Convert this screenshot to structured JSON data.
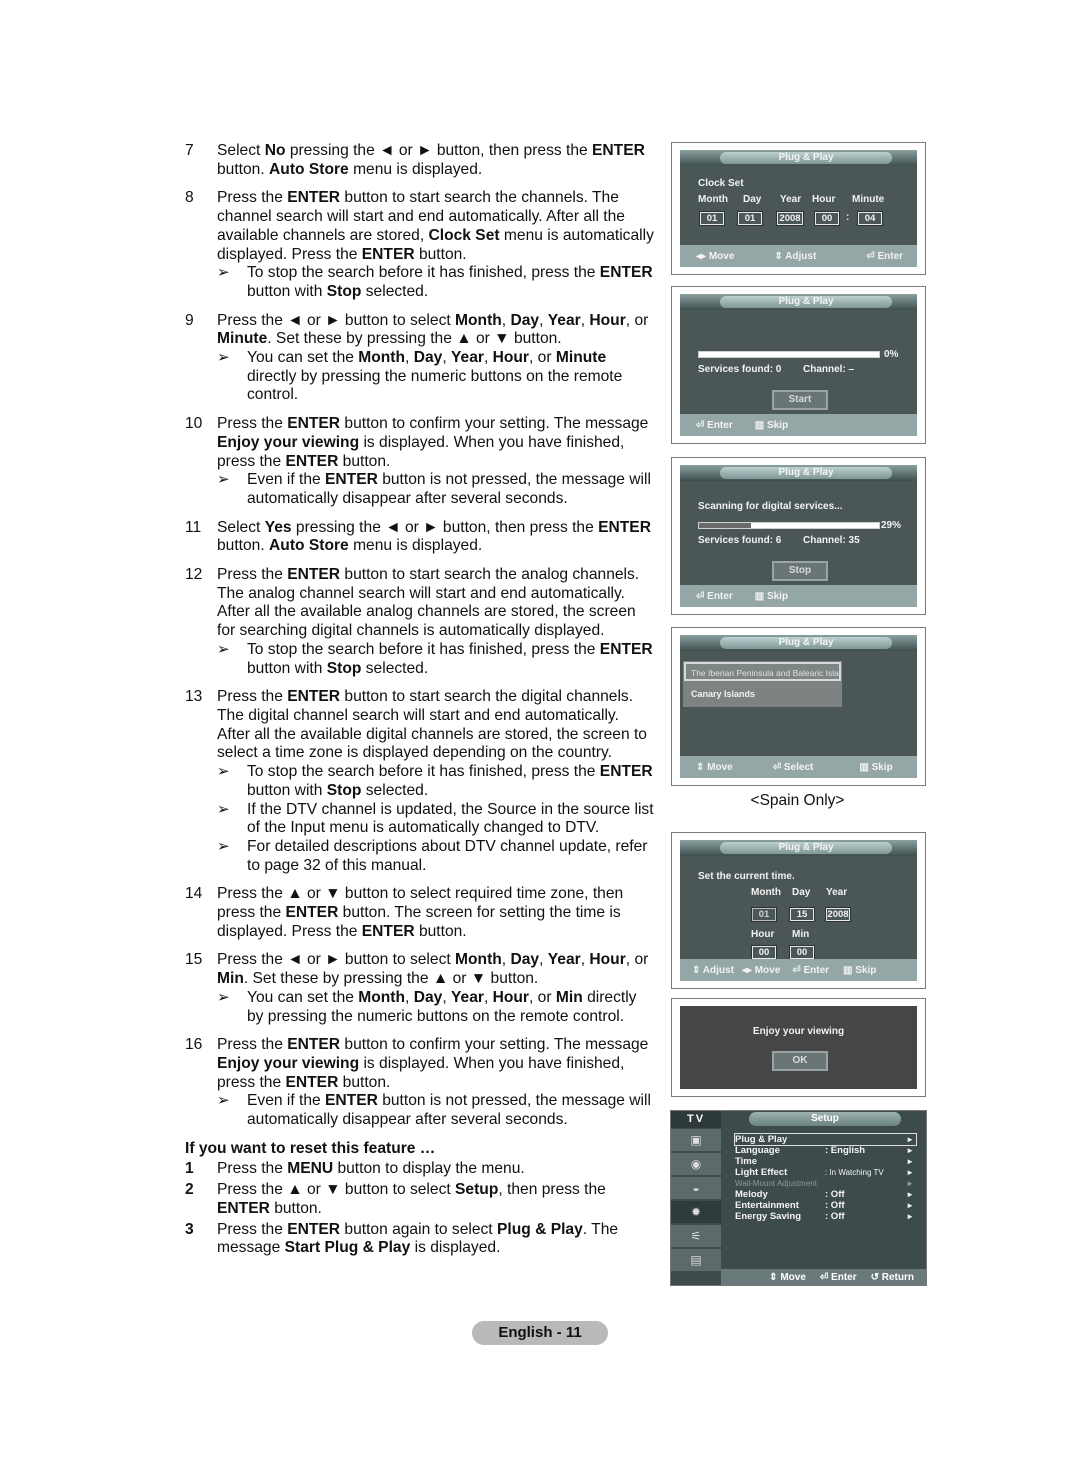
{
  "steps": [
    {
      "num": "7",
      "html": [
        [
          "t",
          "Select "
        ],
        [
          "b",
          "No"
        ],
        [
          "t",
          " pressing the ◄ or ► button, then press the "
        ],
        [
          "b",
          "ENTER"
        ],
        [
          "t",
          " button. "
        ],
        [
          "b",
          "Auto Store"
        ],
        [
          "t",
          " menu is displayed."
        ]
      ],
      "notes": []
    },
    {
      "num": "8",
      "html": [
        [
          "t",
          "Press the "
        ],
        [
          "b",
          "ENTER"
        ],
        [
          "t",
          " button to start search the channels. The channel search will start and end automatically. After all the available channels are stored, "
        ],
        [
          "b",
          "Clock Set"
        ],
        [
          "t",
          " menu is automatically displayed. Press the "
        ],
        [
          "b",
          "ENTER"
        ],
        [
          "t",
          " button."
        ]
      ],
      "notes": [
        [
          [
            "t",
            "To stop the search before it has finished, press the "
          ],
          [
            "b",
            "ENTER"
          ],
          [
            "t",
            " button with "
          ],
          [
            "b",
            "Stop"
          ],
          [
            "t",
            " selected."
          ]
        ]
      ]
    },
    {
      "num": "9",
      "html": [
        [
          "t",
          "Press the ◄ or ► button to select "
        ],
        [
          "b",
          "Month"
        ],
        [
          "t",
          ", "
        ],
        [
          "b",
          "Day"
        ],
        [
          "t",
          ", "
        ],
        [
          "b",
          "Year"
        ],
        [
          "t",
          ", "
        ],
        [
          "b",
          "Hour"
        ],
        [
          "t",
          ", or "
        ],
        [
          "b",
          "Minute"
        ],
        [
          "t",
          ". Set these by pressing the ▲ or ▼ button."
        ]
      ],
      "notes": [
        [
          [
            "t",
            "You can set the "
          ],
          [
            "b",
            "Month"
          ],
          [
            "t",
            ", "
          ],
          [
            "b",
            "Day"
          ],
          [
            "t",
            ", "
          ],
          [
            "b",
            "Year"
          ],
          [
            "t",
            ", "
          ],
          [
            "b",
            "Hour"
          ],
          [
            "t",
            ", or "
          ],
          [
            "b",
            "Minute"
          ],
          [
            "t",
            " directly by pressing the numeric buttons on the remote control."
          ]
        ]
      ]
    },
    {
      "num": "10",
      "html": [
        [
          "t",
          "Press the "
        ],
        [
          "b",
          "ENTER"
        ],
        [
          "t",
          " button to confirm your setting. The message "
        ],
        [
          "b",
          "Enjoy your viewing"
        ],
        [
          "t",
          " is displayed. When you have finished, press the "
        ],
        [
          "b",
          "ENTER"
        ],
        [
          "t",
          " button."
        ]
      ],
      "notes": [
        [
          [
            "t",
            "Even if the "
          ],
          [
            "b",
            "ENTER"
          ],
          [
            "t",
            " button is not pressed, the message will automatically disappear after several seconds."
          ]
        ]
      ]
    },
    {
      "num": "11",
      "html": [
        [
          "t",
          "Select "
        ],
        [
          "b",
          "Yes"
        ],
        [
          "t",
          " pressing the ◄ or ► button, then press the "
        ],
        [
          "b",
          "ENTER"
        ],
        [
          "t",
          " button. "
        ],
        [
          "b",
          "Auto Store"
        ],
        [
          "t",
          " menu is displayed."
        ]
      ],
      "notes": []
    },
    {
      "num": "12",
      "html": [
        [
          "t",
          "Press the "
        ],
        [
          "b",
          "ENTER"
        ],
        [
          "t",
          " button to start search the analog channels. The analog channel search will start and end automatically. After all the available analog channels are stored, the screen for searching digital channels is automatically displayed."
        ]
      ],
      "notes": [
        [
          [
            "t",
            "To stop the search before it has finished, press the "
          ],
          [
            "b",
            "ENTER"
          ],
          [
            "t",
            " button with "
          ],
          [
            "b",
            "Stop"
          ],
          [
            "t",
            " selected."
          ]
        ]
      ]
    },
    {
      "num": "13",
      "html": [
        [
          "t",
          "Press the "
        ],
        [
          "b",
          "ENTER"
        ],
        [
          "t",
          " button to start search the digital channels. The digital channel search will start and end automatically. After all the available digital channels are stored, the screen to select a time zone is displayed depending on the country."
        ]
      ],
      "notes": [
        [
          [
            "t",
            "To stop the search before it has finished, press the "
          ],
          [
            "b",
            "ENTER"
          ],
          [
            "t",
            " button with "
          ],
          [
            "b",
            "Stop"
          ],
          [
            "t",
            " selected."
          ]
        ],
        [
          [
            "t",
            "If the DTV channel is updated, the Source in the source list of the Input menu is automatically changed to DTV."
          ]
        ],
        [
          [
            "t",
            "For detailed descriptions about DTV channel update, refer to page 32 of this manual."
          ]
        ]
      ]
    },
    {
      "num": "14",
      "html": [
        [
          "t",
          "Press the ▲ or ▼ button to select required time zone, then press the "
        ],
        [
          "b",
          "ENTER"
        ],
        [
          "t",
          " button. The screen for setting the time is displayed. Press the "
        ],
        [
          "b",
          "ENTER"
        ],
        [
          "t",
          " button."
        ]
      ],
      "notes": []
    },
    {
      "num": "15",
      "html": [
        [
          "t",
          "Press the ◄ or ► button to select "
        ],
        [
          "b",
          "Month"
        ],
        [
          "t",
          ", "
        ],
        [
          "b",
          "Day"
        ],
        [
          "t",
          ", "
        ],
        [
          "b",
          "Year"
        ],
        [
          "t",
          ", "
        ],
        [
          "b",
          "Hour"
        ],
        [
          "t",
          ", or "
        ],
        [
          "b",
          "Min"
        ],
        [
          "t",
          ". Set these by pressing the ▲ or ▼ button."
        ]
      ],
      "notes": [
        [
          [
            "t",
            "You can set the "
          ],
          [
            "b",
            "Month"
          ],
          [
            "t",
            ", "
          ],
          [
            "b",
            "Day"
          ],
          [
            "t",
            ", "
          ],
          [
            "b",
            "Year"
          ],
          [
            "t",
            ", "
          ],
          [
            "b",
            "Hour"
          ],
          [
            "t",
            ", or "
          ],
          [
            "b",
            "Min"
          ],
          [
            "t",
            " directly by pressing the numeric buttons on the remote control."
          ]
        ]
      ]
    },
    {
      "num": "16",
      "html": [
        [
          "t",
          "Press the "
        ],
        [
          "b",
          "ENTER"
        ],
        [
          "t",
          " button to confirm your setting. The message "
        ],
        [
          "b",
          "Enjoy your viewing"
        ],
        [
          "t",
          " is displayed. When you have finished, press the "
        ],
        [
          "b",
          "ENTER"
        ],
        [
          "t",
          " button."
        ]
      ],
      "notes": [
        [
          [
            "t",
            "Even if the "
          ],
          [
            "b",
            "ENTER"
          ],
          [
            "t",
            " button is not pressed, the message will automatically disappear after several seconds."
          ]
        ]
      ]
    }
  ],
  "note_arrow": "➢",
  "reset": {
    "title": "If you want to reset this feature …",
    "steps": [
      {
        "num": "1",
        "html": [
          [
            "t",
            "Press the "
          ],
          [
            "b",
            "MENU"
          ],
          [
            "t",
            " button to display the menu."
          ]
        ]
      },
      {
        "num": "2",
        "html": [
          [
            "t",
            "Press the ▲ or ▼ button to select "
          ],
          [
            "b",
            "Setup"
          ],
          [
            "t",
            ", then press the "
          ],
          [
            "b",
            "ENTER"
          ],
          [
            "t",
            " button."
          ]
        ]
      },
      {
        "num": "3",
        "html": [
          [
            "t",
            "Press the "
          ],
          [
            "b",
            "ENTER"
          ],
          [
            "t",
            " button again to select "
          ],
          [
            "b",
            "Plug & Play"
          ],
          [
            "t",
            ". The message "
          ],
          [
            "b",
            "Start Plug & Play"
          ],
          [
            "t",
            " is displayed."
          ]
        ]
      }
    ]
  },
  "osd": {
    "title": "Plug & Play",
    "clock": {
      "heading": "Clock Set",
      "labels": [
        "Month",
        "Day",
        "Year",
        "Hour",
        "Minute"
      ],
      "values": [
        "01",
        "01",
        "2008",
        "00",
        "04"
      ],
      "sep": ":",
      "footer": [
        "◂▸ Move",
        "⇕ Adjust",
        "⏎ Enter"
      ]
    },
    "search_start": {
      "progress_percent": 0,
      "progress_label": "0%",
      "services": "Services found: 0",
      "channel": "Channel: –",
      "button": "Start",
      "footer": [
        "⏎ Enter",
        "▥ Skip"
      ]
    },
    "search_digital": {
      "status": "Scanning for digital services...",
      "progress_percent": 29,
      "progress_label": "29%",
      "services": "Services found: 6",
      "channel": "Channel: 35",
      "button": "Stop",
      "footer": [
        "⏎ Enter",
        "▥ Skip"
      ]
    },
    "timezone": {
      "options": [
        "The Iberian Peninsula and Balearic Islands",
        "Canary Islands"
      ],
      "selected": 0,
      "footer": [
        "⇕ Move",
        "⏎ Select",
        "▥ Skip"
      ],
      "caption": "<Spain Only>"
    },
    "settime": {
      "heading": "Set the current time.",
      "date_labels": [
        "Month",
        "Day",
        "Year"
      ],
      "date_values": [
        "01",
        "15",
        "2008"
      ],
      "time_labels": [
        "Hour",
        "Min"
      ],
      "time_values": [
        "00",
        "00"
      ],
      "footer": [
        "⇕ Adjust",
        "◂▸ Move",
        "⏎ Enter",
        "▥ Skip"
      ]
    },
    "enjoy": {
      "message": "Enjoy your viewing",
      "button": "OK"
    },
    "setup": {
      "tab": "TV",
      "title": "Setup",
      "items": [
        {
          "label": "Plug & Play",
          "value": "",
          "selected": true,
          "disabled": false
        },
        {
          "label": "Language",
          "value": ": English",
          "selected": false,
          "disabled": false
        },
        {
          "label": "Time",
          "value": "",
          "selected": false,
          "disabled": false
        },
        {
          "label": "Light Effect",
          "value": ": In Watching TV",
          "selected": false,
          "disabled": false
        },
        {
          "label": "Wall-Mount Adjustment",
          "value": "",
          "selected": false,
          "disabled": true
        },
        {
          "label": "Melody",
          "value": ": Off",
          "selected": false,
          "disabled": false
        },
        {
          "label": "Entertainment",
          "value": ": Off",
          "selected": false,
          "disabled": false
        },
        {
          "label": "Energy Saving",
          "value": ": Off",
          "selected": false,
          "disabled": false
        }
      ],
      "side_icons": [
        "picture-icon",
        "sound-icon",
        "channel-icon",
        "setup-icon",
        "input-icon",
        "digital-menu-icon"
      ],
      "side_selected": 3,
      "footer": [
        "⇕ Move",
        "⏎ Enter",
        "↺ Return"
      ]
    }
  },
  "page_label": "English - 11"
}
